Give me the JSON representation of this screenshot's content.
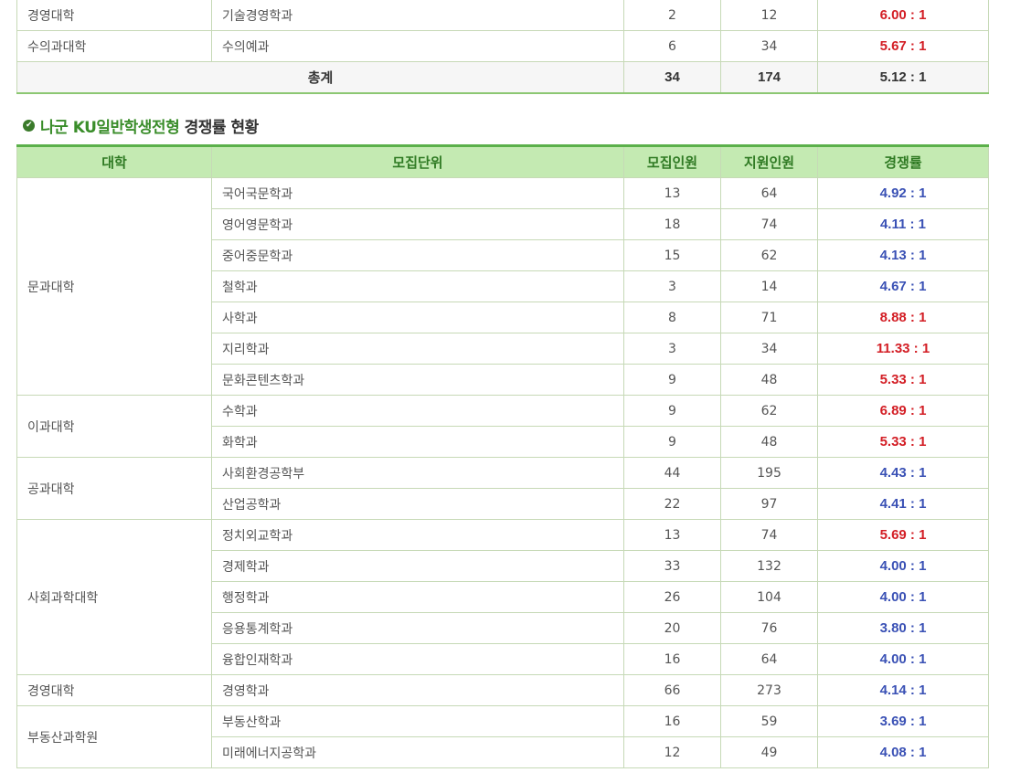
{
  "top_table": {
    "rows": [
      {
        "college": "경영대학",
        "unit": "기술경영학과",
        "quota": "2",
        "applicants": "12",
        "ratio": "6.00 : 1"
      },
      {
        "college": "수의과대학",
        "unit": "수의예과",
        "quota": "6",
        "applicants": "34",
        "ratio": "5.67 : 1"
      }
    ],
    "total": {
      "label": "총계",
      "quota": "34",
      "applicants": "174",
      "ratio": "5.12 : 1"
    }
  },
  "section": {
    "title_highlight": "나군 KU일반학생전형",
    "title_rest": " 경쟁률 현황"
  },
  "main_table": {
    "headers": [
      "대학",
      "모집단위",
      "모집인원",
      "지원인원",
      "경쟁률"
    ],
    "colleges": [
      "문과대학",
      "이과대학",
      "공과대학",
      "사회과학대학",
      "경영대학",
      "부동산과학원"
    ],
    "rows": [
      {
        "unit": "국어국문학과",
        "quota": "13",
        "applicants": "64",
        "ratio": "4.92 : 1"
      },
      {
        "unit": "영어영문학과",
        "quota": "18",
        "applicants": "74",
        "ratio": "4.11 : 1"
      },
      {
        "unit": "중어중문학과",
        "quota": "15",
        "applicants": "62",
        "ratio": "4.13 : 1"
      },
      {
        "unit": "철학과",
        "quota": "3",
        "applicants": "14",
        "ratio": "4.67 : 1"
      },
      {
        "unit": "사학과",
        "quota": "8",
        "applicants": "71",
        "ratio": "8.88 : 1"
      },
      {
        "unit": "지리학과",
        "quota": "3",
        "applicants": "34",
        "ratio": "11.33 : 1"
      },
      {
        "unit": "문화콘텐츠학과",
        "quota": "9",
        "applicants": "48",
        "ratio": "5.33 : 1"
      },
      {
        "unit": "수학과",
        "quota": "9",
        "applicants": "62",
        "ratio": "6.89 : 1"
      },
      {
        "unit": "화학과",
        "quota": "9",
        "applicants": "48",
        "ratio": "5.33 : 1"
      },
      {
        "unit": "사회환경공학부",
        "quota": "44",
        "applicants": "195",
        "ratio": "4.43 : 1"
      },
      {
        "unit": "산업공학과",
        "quota": "22",
        "applicants": "97",
        "ratio": "4.41 : 1"
      },
      {
        "unit": "정치외교학과",
        "quota": "13",
        "applicants": "74",
        "ratio": "5.69 : 1"
      },
      {
        "unit": "경제학과",
        "quota": "33",
        "applicants": "132",
        "ratio": "4.00 : 1"
      },
      {
        "unit": "행정학과",
        "quota": "26",
        "applicants": "104",
        "ratio": "4.00 : 1"
      },
      {
        "unit": "응용통계학과",
        "quota": "20",
        "applicants": "76",
        "ratio": "3.80 : 1"
      },
      {
        "unit": "융합인재학과",
        "quota": "16",
        "applicants": "64",
        "ratio": "4.00 : 1"
      },
      {
        "unit": "경영학과",
        "quota": "66",
        "applicants": "273",
        "ratio": "4.14 : 1"
      },
      {
        "unit": "부동산학과",
        "quota": "16",
        "applicants": "59",
        "ratio": "3.69 : 1"
      },
      {
        "unit": "미래에너지공학과",
        "quota": "12",
        "applicants": "49",
        "ratio": "4.08 : 1"
      }
    ]
  },
  "colors": {
    "high_ratio": "#d31e25",
    "low_ratio": "#3a51b5",
    "header_bg": "#c4eab2",
    "accent_green": "#3a8d2a"
  },
  "icons": {
    "section_marker": "check-circle-icon"
  }
}
